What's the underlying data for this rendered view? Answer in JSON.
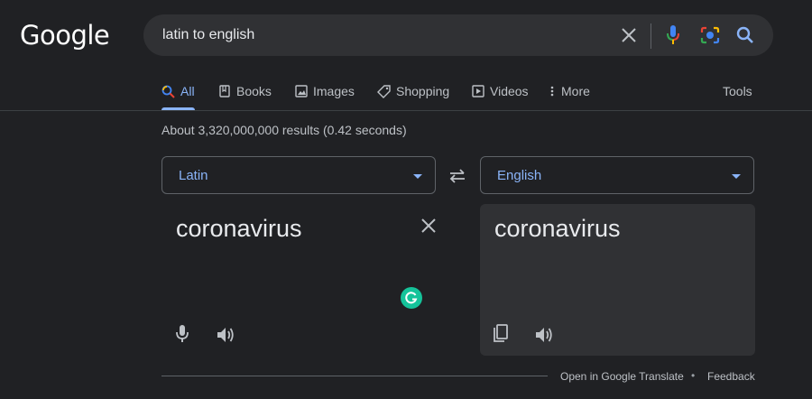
{
  "logo": {
    "text": "Google"
  },
  "search": {
    "query": "latin to english"
  },
  "tabs": [
    {
      "label": "All",
      "icon": "search-icon",
      "active": true
    },
    {
      "label": "Books",
      "icon": "book-icon"
    },
    {
      "label": "Images",
      "icon": "image-icon"
    },
    {
      "label": "Shopping",
      "icon": "tag-icon"
    },
    {
      "label": "Videos",
      "icon": "play-icon"
    },
    {
      "label": "More",
      "icon": "more-vert-icon"
    }
  ],
  "tools_label": "Tools",
  "result_stats": "About 3,320,000,000 results (0.42 seconds)",
  "translator": {
    "source_language": "Latin",
    "target_language": "English",
    "source_text": "coronavirus",
    "target_text": "coronavirus"
  },
  "footer": {
    "open_link": "Open in Google Translate",
    "separator": "•",
    "feedback": "Feedback"
  },
  "colors": {
    "background": "#202124",
    "accent": "#8ab4f8",
    "panel": "#303134",
    "grammarly": "#15c39a"
  }
}
